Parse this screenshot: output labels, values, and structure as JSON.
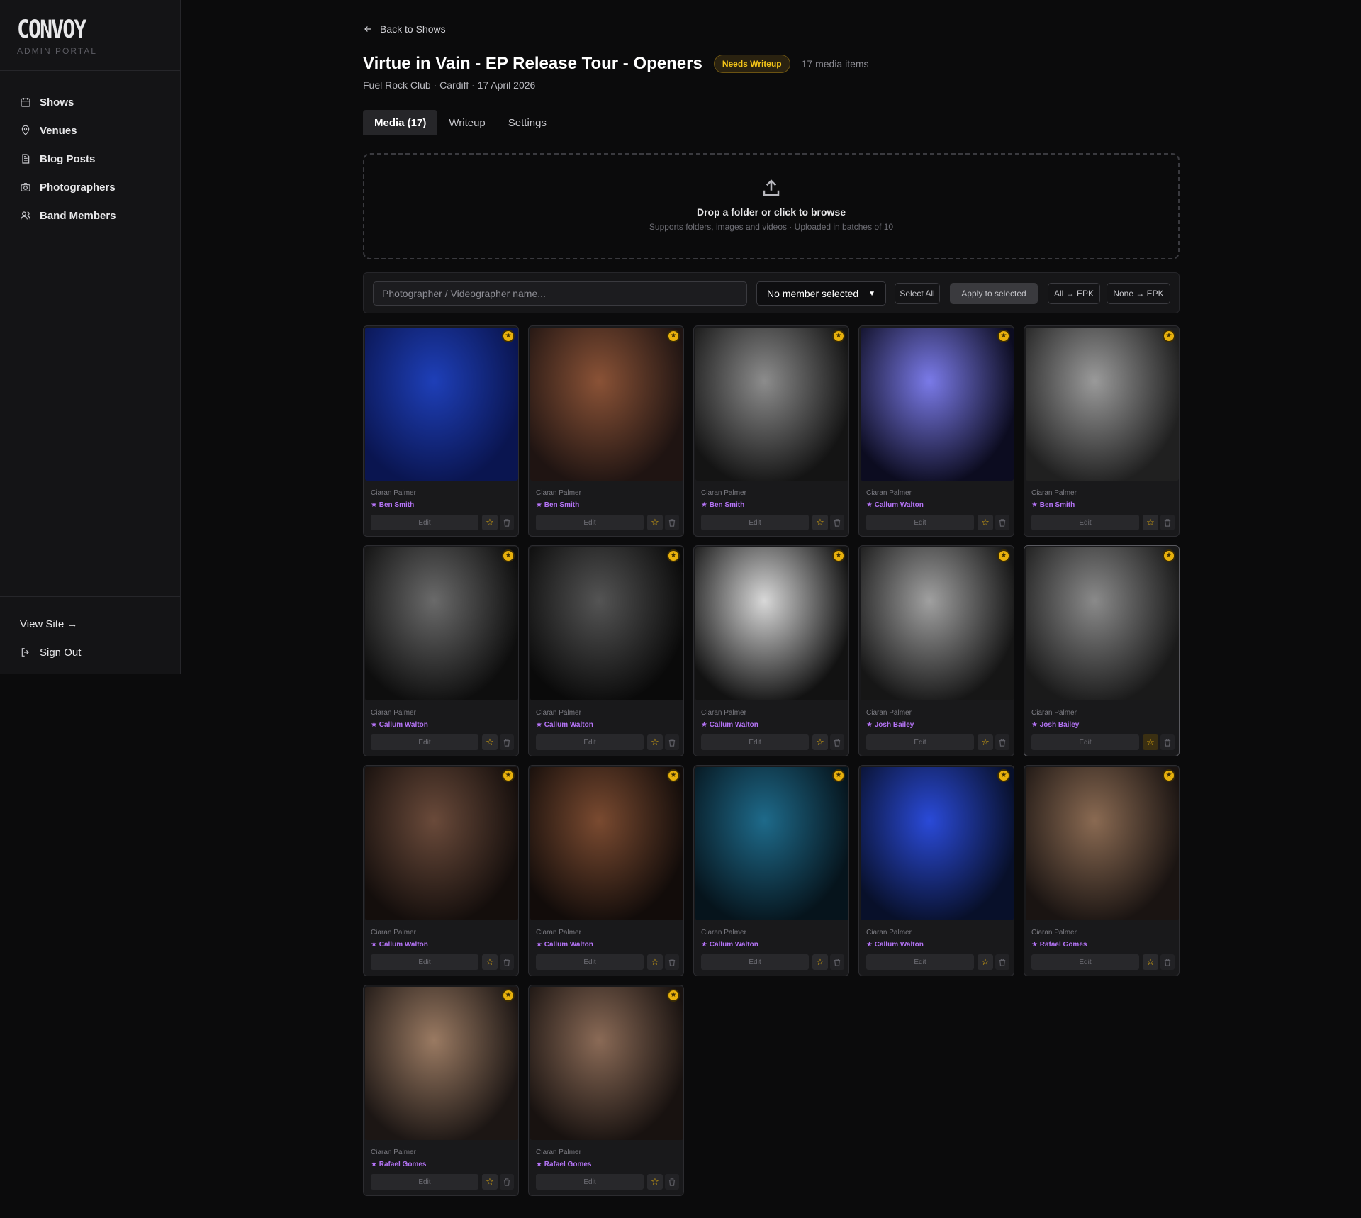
{
  "brand": {
    "logo": "CONVOY",
    "subtitle": "ADMIN PORTAL"
  },
  "sidebar": {
    "items": [
      {
        "label": "Shows",
        "icon": "calendar-icon"
      },
      {
        "label": "Venues",
        "icon": "map-pin-icon"
      },
      {
        "label": "Blog Posts",
        "icon": "document-icon"
      },
      {
        "label": "Photographers",
        "icon": "camera-icon"
      },
      {
        "label": "Band Members",
        "icon": "users-icon"
      }
    ],
    "view_site": "View Site →",
    "sign_out": "Sign Out"
  },
  "header": {
    "back": "Back to Shows",
    "title": "Virtue in Vain - EP Release Tour - Openers",
    "badge": "Needs Writeup",
    "count": "17 media items",
    "subtitle": "Fuel Rock Club · Cardiff · 17 April 2026"
  },
  "tabs": [
    {
      "label": "Media (17)",
      "active": true
    },
    {
      "label": "Writeup",
      "active": false
    },
    {
      "label": "Settings",
      "active": false
    }
  ],
  "dropzone": {
    "title": "Drop a folder or click to browse",
    "subtitle": "Supports folders, images and videos · Uploaded in batches of 10"
  },
  "toolbar": {
    "photographer_placeholder": "Photographer / Videographer name...",
    "member_select": "No member selected",
    "select_all": "Select All",
    "apply": "Apply to selected",
    "all_epk": "All → EPK",
    "none_epk": "None → EPK"
  },
  "colors": {
    "accent_gold": "#e8b10c",
    "member_purple": "#b473f5",
    "badge_text": "#f5c518"
  },
  "media": [
    {
      "photographer": "Ciaran Palmer",
      "member": "★ Ben Smith",
      "edit": "Edit",
      "tone": "#1e3fb8",
      "tone2": "#0a1550",
      "epk": true
    },
    {
      "photographer": "Ciaran Palmer",
      "member": "★ Ben Smith",
      "edit": "Edit",
      "tone": "#8a5236",
      "tone2": "#1f1412",
      "epk": true
    },
    {
      "photographer": "Ciaran Palmer",
      "member": "★ Ben Smith",
      "edit": "Edit",
      "tone": "#8c8c8c",
      "tone2": "#141414",
      "epk": true
    },
    {
      "photographer": "Ciaran Palmer",
      "member": "★ Callum Walton",
      "edit": "Edit",
      "tone": "#7a7ae8",
      "tone2": "#0c0c20",
      "epk": true
    },
    {
      "photographer": "Ciaran Palmer",
      "member": "★ Ben Smith",
      "edit": "Edit",
      "tone": "#9a9a9a",
      "tone2": "#202020",
      "epk": true
    },
    {
      "photographer": "Ciaran Palmer",
      "member": "★ Callum Walton",
      "edit": "Edit",
      "tone": "#6a6a6a",
      "tone2": "#0e0e0e",
      "epk": true
    },
    {
      "photographer": "Ciaran Palmer",
      "member": "★ Callum Walton",
      "edit": "Edit",
      "tone": "#545454",
      "tone2": "#0a0a0a",
      "epk": true
    },
    {
      "photographer": "Ciaran Palmer",
      "member": "★ Callum Walton",
      "edit": "Edit",
      "tone": "#d8d8d8",
      "tone2": "#121212",
      "epk": true
    },
    {
      "photographer": "Ciaran Palmer",
      "member": "★ Josh Bailey",
      "edit": "Edit",
      "tone": "#a0a0a0",
      "tone2": "#161616",
      "epk": true
    },
    {
      "photographer": "Ciaran Palmer",
      "member": "★ Josh Bailey",
      "edit": "Edit",
      "tone": "#8a8a8a",
      "tone2": "#1a1a1a",
      "epk": true,
      "selected": true
    },
    {
      "photographer": "Ciaran Palmer",
      "member": "★ Callum Walton",
      "edit": "Edit",
      "tone": "#6a4a3a",
      "tone2": "#140e0c",
      "epk": true
    },
    {
      "photographer": "Ciaran Palmer",
      "member": "★ Callum Walton",
      "edit": "Edit",
      "tone": "#7a4a30",
      "tone2": "#120c0a",
      "epk": true
    },
    {
      "photographer": "Ciaran Palmer",
      "member": "★ Callum Walton",
      "edit": "Edit",
      "tone": "#1e6a8a",
      "tone2": "#06141c",
      "epk": true
    },
    {
      "photographer": "Ciaran Palmer",
      "member": "★ Callum Walton",
      "edit": "Edit",
      "tone": "#2a4ad8",
      "tone2": "#08102a",
      "epk": true
    },
    {
      "photographer": "Ciaran Palmer",
      "member": "★ Rafael Gomes",
      "edit": "Edit",
      "tone": "#8a6a52",
      "tone2": "#1a1412",
      "epk": true
    },
    {
      "photographer": "Ciaran Palmer",
      "member": "★ Rafael Gomes",
      "edit": "Edit",
      "tone": "#9a7a62",
      "tone2": "#1c1614",
      "epk": true
    },
    {
      "photographer": "Ciaran Palmer",
      "member": "★ Rafael Gomes",
      "edit": "Edit",
      "tone": "#8a6a56",
      "tone2": "#181210",
      "epk": true
    }
  ]
}
